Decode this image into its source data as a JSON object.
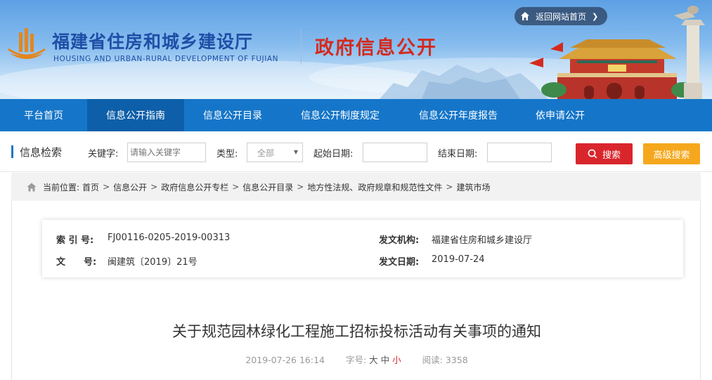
{
  "header": {
    "brand_cn": "福建省住房和城乡建设厅",
    "brand_en": "HOUSING AND URBAN-RURAL DEVELOPMENT OF FUJIAN",
    "section_title": "政府信息公开",
    "return_link": "返回网站首页"
  },
  "nav": {
    "items": [
      {
        "label": "平台首页"
      },
      {
        "label": "信息公开指南"
      },
      {
        "label": "信息公开目录"
      },
      {
        "label": "信息公开制度规定"
      },
      {
        "label": "信息公开年度报告"
      },
      {
        "label": "依申请公开"
      }
    ],
    "active_label": "信息公开指南"
  },
  "search": {
    "title": "信息检索",
    "keyword_label": "关键字:",
    "keyword_placeholder": "请输入关键字",
    "type_label": "类型:",
    "type_value": "全部",
    "start_label": "起始日期:",
    "end_label": "结束日期:",
    "search_button": "搜索",
    "advanced_button": "高级搜索"
  },
  "breadcrumb": {
    "prefix": "当前位置:",
    "items": [
      "首页",
      "信息公开",
      "政府信息公开专栏",
      "信息公开目录",
      "地方性法规、政府规章和规范性文件",
      "建筑市场"
    ]
  },
  "meta": {
    "index_label": "索 引 号:",
    "index_value": "FJ00116-0205-2019-00313",
    "issuer_label": "发文机构:",
    "issuer_value": "福建省住房和城乡建设厅",
    "docno_label": "文　　号:",
    "docno_value": "闽建筑〔2019〕21号",
    "date_label": "发文日期:",
    "date_value": "2019-07-24"
  },
  "article": {
    "title": "关于规范园林绿化工程施工招标投标活动有关事项的通知",
    "published": "2019-07-26 16:14",
    "font_size_label": "字号:",
    "font_large": "大",
    "font_medium": "中",
    "font_small": "小",
    "views_label": "阅读:",
    "views": "3358"
  },
  "colors": {
    "nav_blue": "#1576c9",
    "nav_active": "#0d5fa9",
    "search_red": "#d9262c",
    "advanced_orange": "#f5a81d",
    "brand_blue": "#1d4fa6",
    "section_red": "#d42a1d"
  }
}
